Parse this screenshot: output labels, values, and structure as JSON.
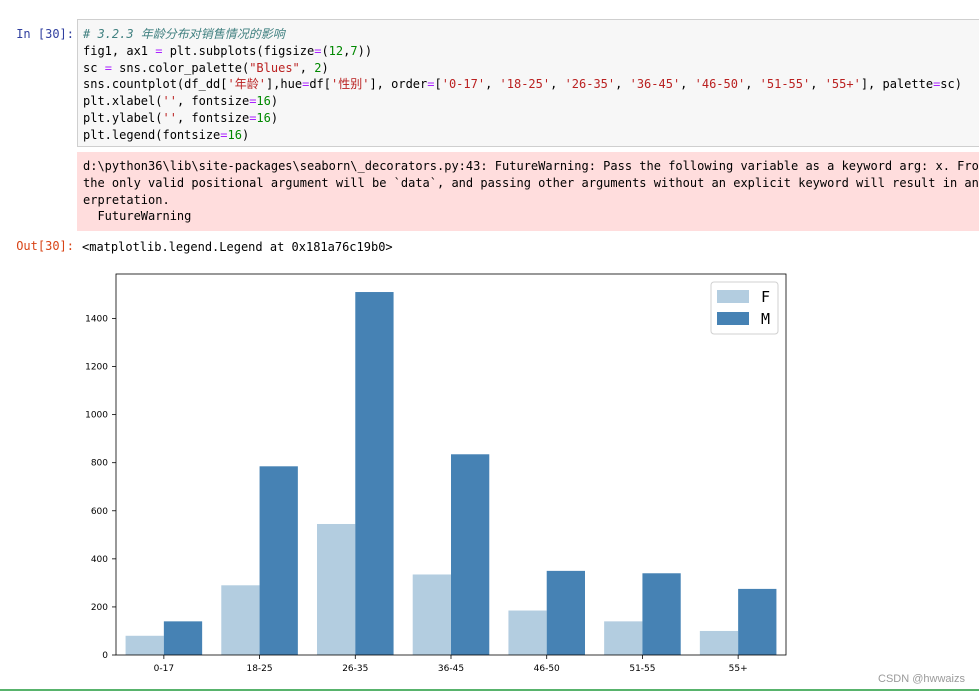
{
  "cell": {
    "in_prompt": "In  [30]:",
    "out_prompt": "Out[30]:",
    "code": {
      "comment": "# 3.2.3 年龄分布对销售情况的影响",
      "line2_a": "fig1, ax1 ",
      "line2_b": "=",
      "line2_c": " plt.subplots(figsize",
      "line2_d": "=",
      "line2_e": "(",
      "line2_f": "12",
      "line2_g": ",",
      "line2_h": "7",
      "line2_i": "))",
      "line3_a": "sc ",
      "line3_b": "=",
      "line3_c": " sns.color_palette(",
      "line3_d": "\"Blues\"",
      "line3_e": ", ",
      "line3_f": "2",
      "line3_g": ")",
      "line4_a": "sns.countplot(df_dd[",
      "line4_b": "'年龄'",
      "line4_c": "],hue",
      "line4_d": "=",
      "line4_e": "df[",
      "line4_f": "'性别'",
      "line4_g": "], order",
      "line4_h": "=",
      "line4_i": "[",
      "line4_j": "'0-17'",
      "line4_k": ", ",
      "line4_l": "'18-25'",
      "line4_m": ", ",
      "line4_n": "'26-35'",
      "line4_o": ", ",
      "line4_p": "'36-45'",
      "line4_q": ", ",
      "line4_r": "'46-50'",
      "line4_s": ", ",
      "line4_t": "'51-55'",
      "line4_u": ", ",
      "line4_v": "'55+'",
      "line4_w": "], palette",
      "line4_x": "=",
      "line4_y": "sc)",
      "line5_a": "plt.xlabel(",
      "line5_b": "''",
      "line5_c": ", fontsize",
      "line5_d": "=",
      "line5_e": "16",
      "line5_f": ")",
      "line6_a": "plt.ylabel(",
      "line6_b": "''",
      "line6_c": ", fontsize",
      "line6_d": "=",
      "line6_e": "16",
      "line6_f": ")",
      "line7_a": "plt.legend(fontsize",
      "line7_b": "=",
      "line7_c": "16",
      "line7_d": ")"
    },
    "stderr": "d:\\python36\\lib\\site-packages\\seaborn\\_decorators.py:43: FutureWarning: Pass the following variable as a keyword arg: x. From ver\nthe only valid positional argument will be `data`, and passing other arguments without an explicit keyword will result in an err\nerpretation.\n  FutureWarning",
    "output_text": "<matplotlib.legend.Legend at 0x181a76c19b0>"
  },
  "watermark": "CSDN @hwwaizs",
  "colors": {
    "F": "#b3cde0",
    "M": "#4682b4",
    "stderr_bg": "#ffdddd",
    "footer_line": "#58b36c"
  },
  "chart_data": {
    "type": "bar",
    "categories": [
      "0-17",
      "18-25",
      "26-35",
      "36-45",
      "46-50",
      "51-55",
      "55+"
    ],
    "series": [
      {
        "name": "F",
        "values": [
          80,
          290,
          545,
          335,
          185,
          140,
          100
        ]
      },
      {
        "name": "M",
        "values": [
          140,
          785,
          1510,
          835,
          350,
          340,
          275
        ]
      }
    ],
    "yticks": [
      0,
      200,
      400,
      600,
      800,
      1000,
      1200,
      1400
    ],
    "ylim": [
      0,
      1585
    ],
    "xlabel": "",
    "ylabel": "",
    "legend_position": "top-right",
    "grid": false
  }
}
